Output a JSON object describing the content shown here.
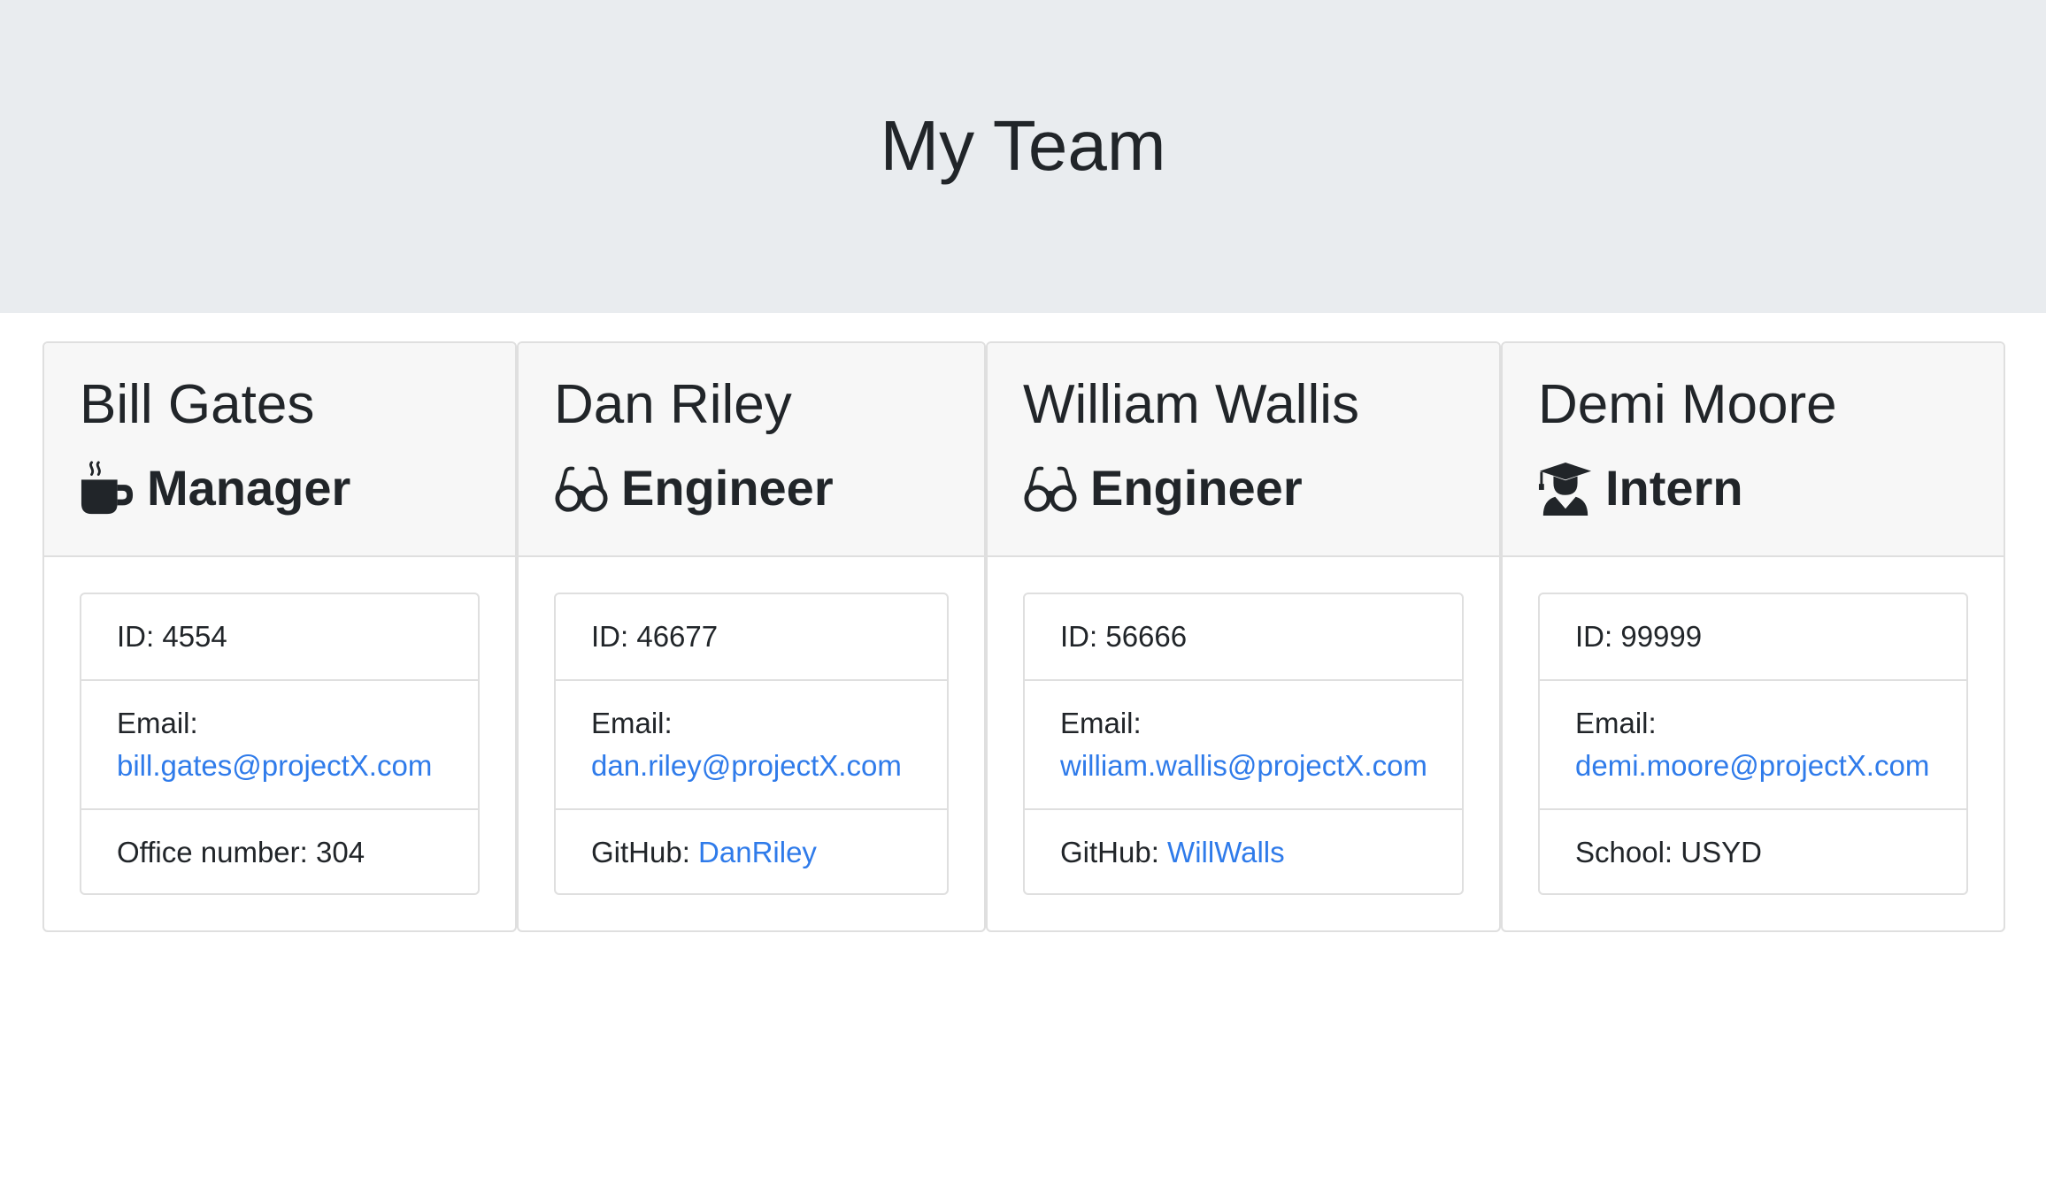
{
  "header": {
    "title": "My Team"
  },
  "employees": [
    {
      "name": "Bill Gates",
      "role": "Manager",
      "role_icon": "coffee-mug-icon",
      "id_text": "ID: 4554",
      "email_label": "Email:",
      "email": "bill.gates@projectX.com",
      "extra_label": "Office number: 304",
      "extra_link": ""
    },
    {
      "name": "Dan Riley",
      "role": "Engineer",
      "role_icon": "glasses-icon",
      "id_text": "ID: 46677",
      "email_label": "Email:",
      "email": "dan.riley@projectX.com",
      "extra_label": "GitHub: ",
      "extra_link": "DanRiley"
    },
    {
      "name": "William Wallis",
      "role": "Engineer",
      "role_icon": "glasses-icon",
      "id_text": "ID: 56666",
      "email_label": "Email:",
      "email": "william.wallis@projectX.com",
      "extra_label": "GitHub: ",
      "extra_link": "WillWalls"
    },
    {
      "name": "Demi Moore",
      "role": "Intern",
      "role_icon": "graduate-icon",
      "id_text": "ID: 99999",
      "email_label": "Email:",
      "email": "demi.moore@projectX.com",
      "extra_label": "School: USYD",
      "extra_link": ""
    }
  ],
  "colors": {
    "link": "#2f7bea",
    "header_bg": "#e9ecef",
    "card_header_bg": "#f7f7f7",
    "border": "#dfdfdf"
  }
}
